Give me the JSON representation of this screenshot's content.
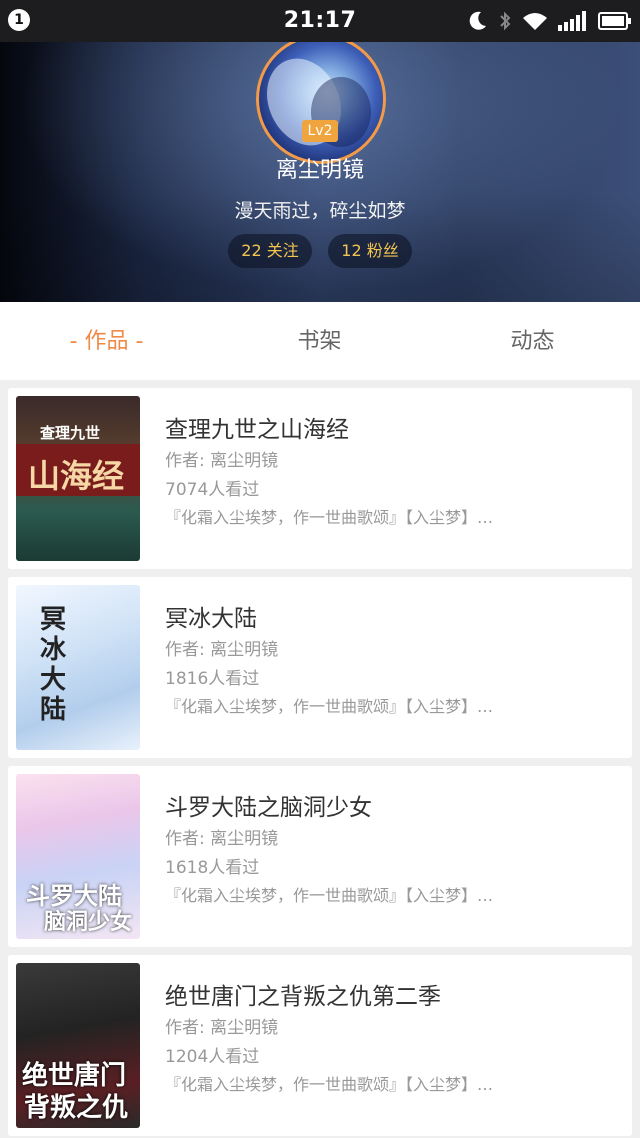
{
  "status_bar": {
    "notification_count": "1",
    "time": "21:17"
  },
  "profile": {
    "level": "Lv2",
    "username": "离尘明镜",
    "signature": "漫天雨过，碎尘如梦",
    "following": "22 关注",
    "followers": "12 粉丝"
  },
  "tabs": [
    "- 作品 -",
    "书架",
    "动态"
  ],
  "books": [
    {
      "title": "查理九世之山海经",
      "author": "作者: 离尘明镜",
      "views": "7074人看过",
      "desc": "『化霜入尘埃梦，作一世曲歌颂』【入尘梦】…",
      "cover_text": "山海经",
      "cover_sub": "查理九世"
    },
    {
      "title": "冥冰大陆",
      "author": "作者: 离尘明镜",
      "views": "1816人看过",
      "desc": "『化霜入尘埃梦，作一世曲歌颂』【入尘梦】…",
      "cover_text": "冥冰大陆"
    },
    {
      "title": "斗罗大陆之脑洞少女",
      "author": "作者: 离尘明镜",
      "views": "1618人看过",
      "desc": "『化霜入尘埃梦，作一世曲歌颂』【入尘梦】…",
      "cover_text": "斗罗大陆",
      "cover_sub": "脑洞少女"
    },
    {
      "title": "绝世唐门之背叛之仇第二季",
      "author": "作者: 离尘明镜",
      "views": "1204人看过",
      "desc": "『化霜入尘埃梦，作一世曲歌颂』【入尘梦】…",
      "cover_text": "绝世唐门",
      "cover_sub": "背叛之仇"
    }
  ],
  "colors": {
    "accent": "#f08a48",
    "level_badge": "#f0a43e",
    "pill_text": "#f4c451"
  }
}
